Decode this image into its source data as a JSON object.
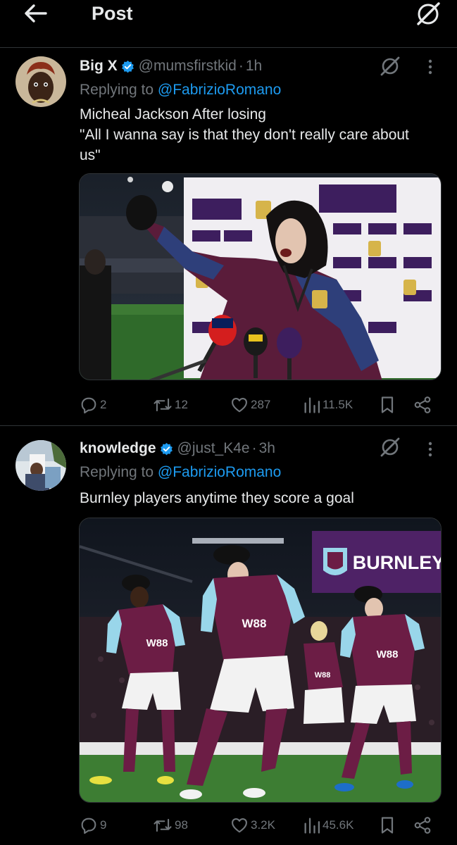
{
  "header": {
    "title": "Post"
  },
  "tweets": [
    {
      "name": "Big X",
      "handle": "@mumsfirstkid",
      "time": "1h",
      "replying_prefix": "Replying to ",
      "replying_to": "@FabrizioRomano",
      "text_lines": [
        "Micheal Jackson After losing",
        "\"All I wanna say is that they don't really care about",
        "us\""
      ],
      "image_alt": "Man in Burnley jacket speaking at Premier League interview board",
      "replies": "2",
      "reposts": "12",
      "likes": "287",
      "views": "11.5K"
    },
    {
      "name": "knowledge",
      "handle": "@just_K4e",
      "time": "3h",
      "replying_prefix": "Replying to ",
      "replying_to": "@FabrizioRomano",
      "text_lines": [
        "Burnley players anytime they score a goal"
      ],
      "image_alt": "Burnley players in hats doing a dance celebration",
      "board_text": "BURNLEY",
      "shirt_sponsor": "W88",
      "replies": "9",
      "reposts": "98",
      "likes": "3.2K",
      "views": "45.6K"
    }
  ],
  "colors": {
    "accent": "#1d9bf0",
    "muted": "#71767b",
    "text": "#e7e9ea",
    "claret": "#6c1d45",
    "sky_blue": "#99d6ea"
  }
}
